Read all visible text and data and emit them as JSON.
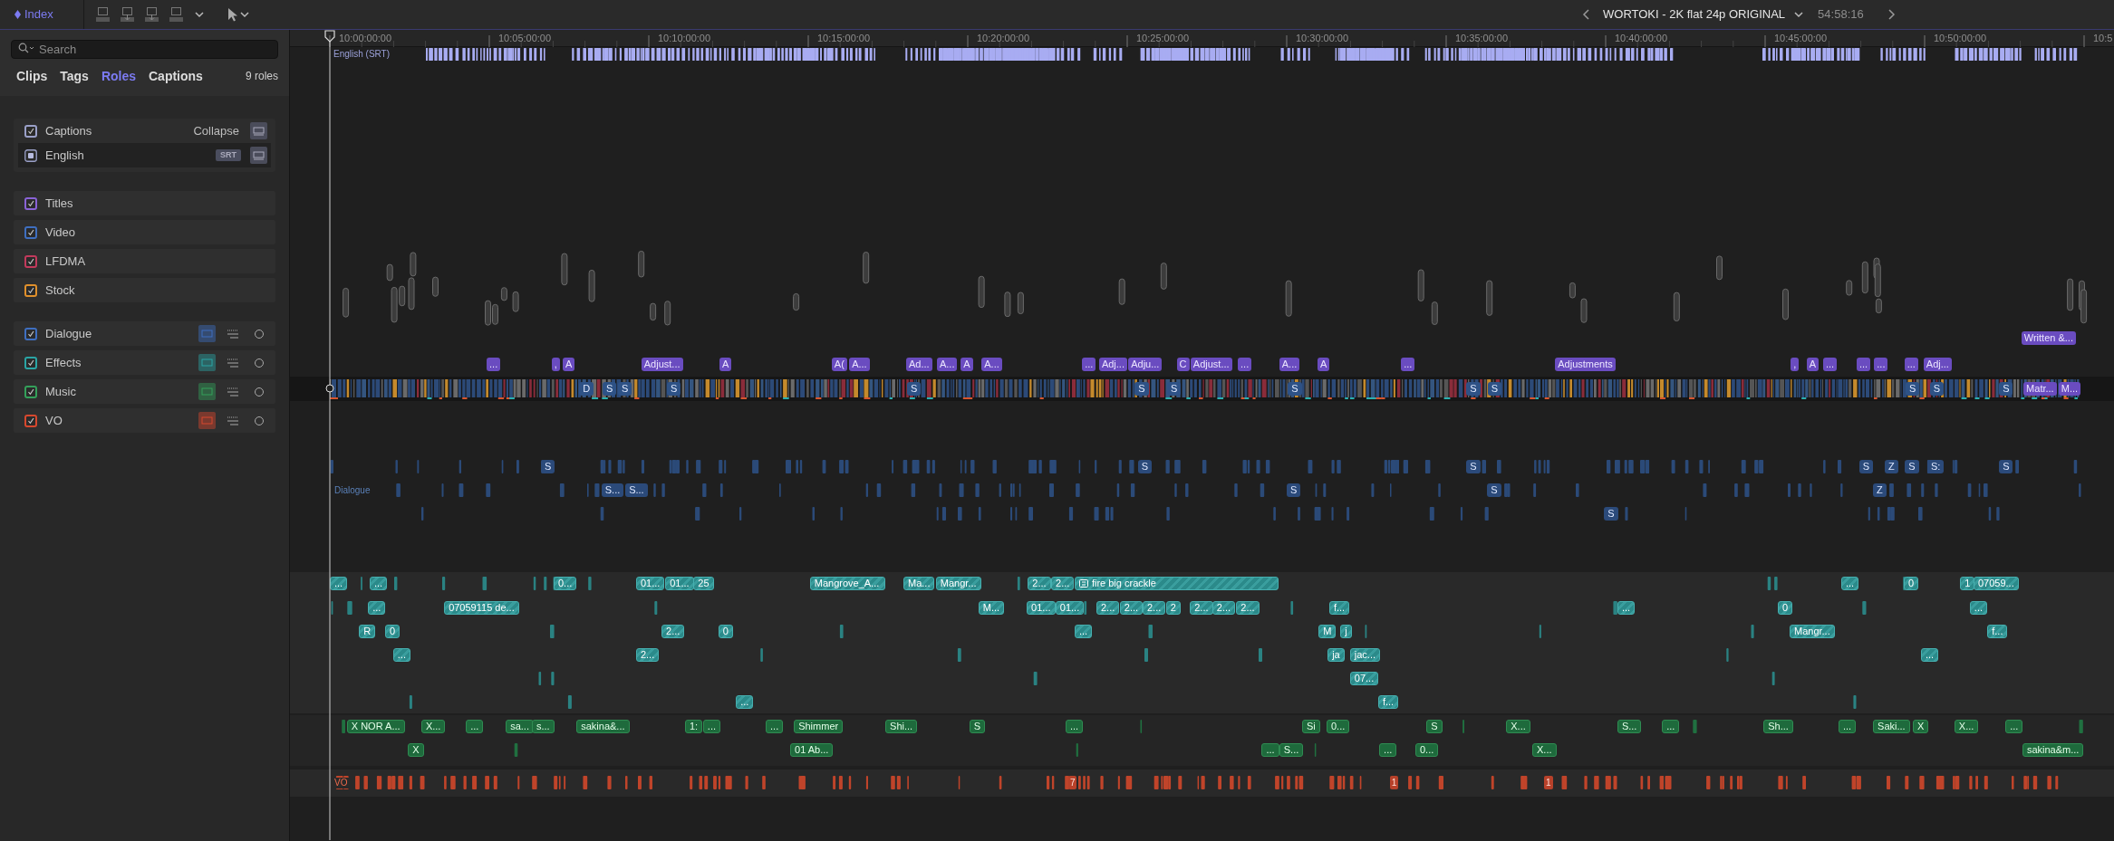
{
  "toolbar": {
    "index": "Index"
  },
  "sidebar": {
    "search": {
      "placeholder": "Search"
    },
    "tabs": [
      {
        "label": "Clips",
        "selected": false
      },
      {
        "label": "Tags",
        "selected": false
      },
      {
        "label": "Roles",
        "selected": true
      },
      {
        "label": "Captions",
        "selected": false
      }
    ],
    "count": "9 roles",
    "captions": {
      "label": "Captions",
      "checked": true,
      "action": "Collapse",
      "subroles": [
        {
          "label": "English",
          "format": "SRT",
          "active": true
        }
      ]
    },
    "video_roles": [
      {
        "label": "Titles",
        "checked": true,
        "color": "#8a63d6"
      },
      {
        "label": "Video",
        "checked": true,
        "color": "#3f6fc0"
      },
      {
        "label": "LFDMA",
        "checked": true,
        "color": "#c23a5c"
      },
      {
        "label": "Stock",
        "checked": true,
        "color": "#e0902c"
      }
    ],
    "audio_roles": [
      {
        "label": "Dialogue",
        "checked": true,
        "color": "#3f6fc0"
      },
      {
        "label": "Effects",
        "checked": true,
        "color": "#2aa5a5"
      },
      {
        "label": "Music",
        "checked": true,
        "color": "#34a05a"
      },
      {
        "label": "VO",
        "checked": true,
        "color": "#d6482e"
      }
    ]
  },
  "timeline": {
    "title": "WORTOKI - 2K flat 24p ORIGINAL",
    "duration": "54:58:16",
    "ruler": [
      "10:00:00:00",
      "10:05:00:00",
      "10:10:00:00",
      "10:15:00:00",
      "10:20:00:00",
      "10:25:00:00",
      "10:30:00:00",
      "10:35:00:00",
      "10:40:00:00",
      "10:45:00:00",
      "10:50:00:00",
      "10:5"
    ],
    "caption_lane": {
      "label": "English (SRT)"
    },
    "lanes": [
      {
        "kind": "title",
        "clips": [
          {
            "label": "Written &..."
          },
          {
            "label": "..."
          },
          {
            "label": ","
          },
          {
            "label": "A"
          },
          {
            "label": "Adjust..."
          },
          {
            "label": "A"
          },
          {
            "label": "A("
          },
          {
            "label": "A..."
          },
          {
            "label": "Ad..."
          },
          {
            "label": "A..."
          },
          {
            "label": "A"
          },
          {
            "label": "A..."
          },
          {
            "label": "..."
          },
          {
            "label": "Adj..."
          },
          {
            "label": "Adju..."
          },
          {
            "label": "C"
          },
          {
            "label": "Adjust..."
          },
          {
            "label": "..."
          },
          {
            "label": "A..."
          },
          {
            "label": "A"
          },
          {
            "label": "..."
          },
          {
            "label": "Adjustments"
          },
          {
            "label": ","
          },
          {
            "label": "A"
          },
          {
            "label": "..."
          },
          {
            "label": "..."
          },
          {
            "label": "..."
          },
          {
            "label": "..."
          },
          {
            "label": "Adj..."
          }
        ]
      },
      {
        "kind": "storyline",
        "clips": [
          {
            "label": "D",
            "kind": "video"
          },
          {
            "label": "S",
            "kind": "video"
          },
          {
            "label": "S",
            "kind": "video"
          },
          {
            "label": "S",
            "kind": "video"
          },
          {
            "label": "S",
            "kind": "video"
          },
          {
            "label": "S",
            "kind": "video"
          },
          {
            "label": "S",
            "kind": "video"
          },
          {
            "label": "S",
            "kind": "video"
          },
          {
            "label": "S",
            "kind": "video"
          },
          {
            "label": "S",
            "kind": "video"
          },
          {
            "label": "S",
            "kind": "video"
          },
          {
            "label": "S",
            "kind": "video"
          },
          {
            "label": "S",
            "kind": "video"
          },
          {
            "label": "Matr...",
            "kind": "title"
          },
          {
            "label": "M...",
            "kind": "title"
          }
        ]
      },
      {
        "kind": "dialogue",
        "label": "Dialogue",
        "clips": [
          {
            "label": "S"
          },
          {
            "label": "S"
          },
          {
            "label": "S"
          },
          {
            "label": "S"
          },
          {
            "label": "Z"
          },
          {
            "label": "S"
          },
          {
            "label": "S:"
          },
          {
            "label": "S"
          },
          {
            "label": "S..."
          },
          {
            "label": "S..."
          },
          {
            "label": "S"
          },
          {
            "label": "S"
          },
          {
            "label": "Z"
          },
          {
            "label": "S"
          }
        ]
      },
      {
        "kind": "effects",
        "clips": [
          {
            "label": "..."
          },
          {
            "label": "..."
          },
          {
            "label": "0..."
          },
          {
            "label": "01..."
          },
          {
            "label": "01..."
          },
          {
            "label": "25"
          },
          {
            "label": "Mangrove_A..."
          },
          {
            "label": "Ma..."
          },
          {
            "label": "Mangr..."
          },
          {
            "label": "2..."
          },
          {
            "label": "2..."
          },
          {
            "label": "fire big crackle",
            "icon": true
          },
          {
            "label": "..."
          },
          {
            "label": "0"
          },
          {
            "label": "1"
          },
          {
            "label": "07059..."
          },
          {
            "label": "..."
          },
          {
            "label": "07059115 de..."
          },
          {
            "label": "M..."
          },
          {
            "label": "01..."
          },
          {
            "label": "01..."
          },
          {
            "label": "2..."
          },
          {
            "label": "2..."
          },
          {
            "label": "2..."
          },
          {
            "label": "2"
          },
          {
            "label": "2..."
          },
          {
            "label": "2..."
          },
          {
            "label": "2..."
          },
          {
            "label": "f..."
          },
          {
            "label": "..."
          },
          {
            "label": "0"
          },
          {
            "label": "..."
          },
          {
            "label": "R"
          },
          {
            "label": "0"
          },
          {
            "label": "2..."
          },
          {
            "label": "0"
          },
          {
            "label": "..."
          },
          {
            "label": "M"
          },
          {
            "label": "j"
          },
          {
            "label": "Mangr..."
          },
          {
            "label": "f..."
          },
          {
            "label": "..."
          },
          {
            "label": "2..."
          },
          {
            "label": "ja"
          },
          {
            "label": "jac..."
          },
          {
            "label": "..."
          },
          {
            "label": "07..."
          },
          {
            "label": "..."
          },
          {
            "label": "f..."
          }
        ]
      },
      {
        "kind": "music",
        "clips": [
          {
            "label": "X NOR A..."
          },
          {
            "label": "X..."
          },
          {
            "label": "..."
          },
          {
            "label": "sa..."
          },
          {
            "label": "s..."
          },
          {
            "label": "sakina&..."
          },
          {
            "label": "1:"
          },
          {
            "label": "..."
          },
          {
            "label": "..."
          },
          {
            "label": "Shimmer"
          },
          {
            "label": "Shi..."
          },
          {
            "label": "S"
          },
          {
            "label": "..."
          },
          {
            "label": "Si"
          },
          {
            "label": "0..."
          },
          {
            "label": "S"
          },
          {
            "label": "X..."
          },
          {
            "label": "S..."
          },
          {
            "label": "..."
          },
          {
            "label": "Sh..."
          },
          {
            "label": "..."
          },
          {
            "label": "Saki..."
          },
          {
            "label": "X"
          },
          {
            "label": "X..."
          },
          {
            "label": "..."
          },
          {
            "label": "X"
          },
          {
            "label": "01 Ab..."
          },
          {
            "label": "..."
          },
          {
            "label": "S..."
          },
          {
            "label": "..."
          },
          {
            "label": "0..."
          },
          {
            "label": "X..."
          },
          {
            "label": "sakina&m..."
          }
        ]
      },
      {
        "kind": "vo",
        "label": "VO",
        "clips": [
          {
            "label": "7"
          },
          {
            "label": "1"
          },
          {
            "label": "1"
          }
        ]
      }
    ]
  }
}
